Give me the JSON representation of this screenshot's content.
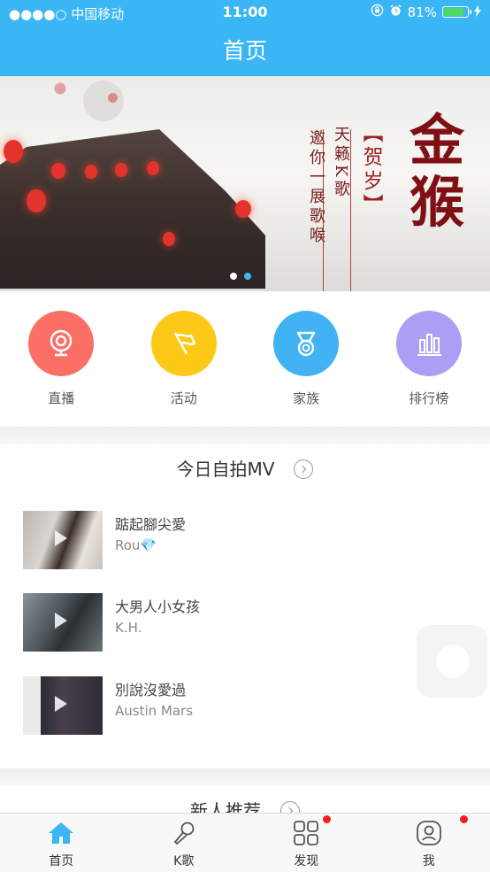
{
  "status": {
    "carrier": "●●●●○ 中国移动",
    "time": "11:00",
    "battery": "81%"
  },
  "header": {
    "title": "首页"
  },
  "banner": {
    "line1": "邀你一展歌喉",
    "line2": "天籁K歌",
    "line3": "【贺岁】",
    "headline": "金猴"
  },
  "menu": [
    {
      "label": "直播",
      "icon": "webcam-icon",
      "color": "#fb6f64"
    },
    {
      "label": "活动",
      "icon": "flag-icon",
      "color": "#fcc916"
    },
    {
      "label": "家族",
      "icon": "medal-icon",
      "color": "#41b2f4"
    },
    {
      "label": "排行榜",
      "icon": "bar-chart-icon",
      "color": "#a99ff5"
    }
  ],
  "mv_section": {
    "title": "今日自拍MV"
  },
  "mv_items": [
    {
      "title": "踮起腳尖愛",
      "author": "Rou💎"
    },
    {
      "title": "大男人小女孩",
      "author": "K.H."
    },
    {
      "title": "別說沒愛過",
      "author": "Austin Mars"
    }
  ],
  "new_section": {
    "title": "新人推荐"
  },
  "tabs": [
    {
      "label": "首页",
      "icon": "home-icon",
      "active": true
    },
    {
      "label": "K歌",
      "icon": "microphone-icon"
    },
    {
      "label": "发现",
      "icon": "grid-icon",
      "badge": true
    },
    {
      "label": "我",
      "icon": "profile-icon",
      "badge": true
    }
  ],
  "colors": {
    "primary": "#3bb6f5",
    "badge": "#f21e1e"
  }
}
